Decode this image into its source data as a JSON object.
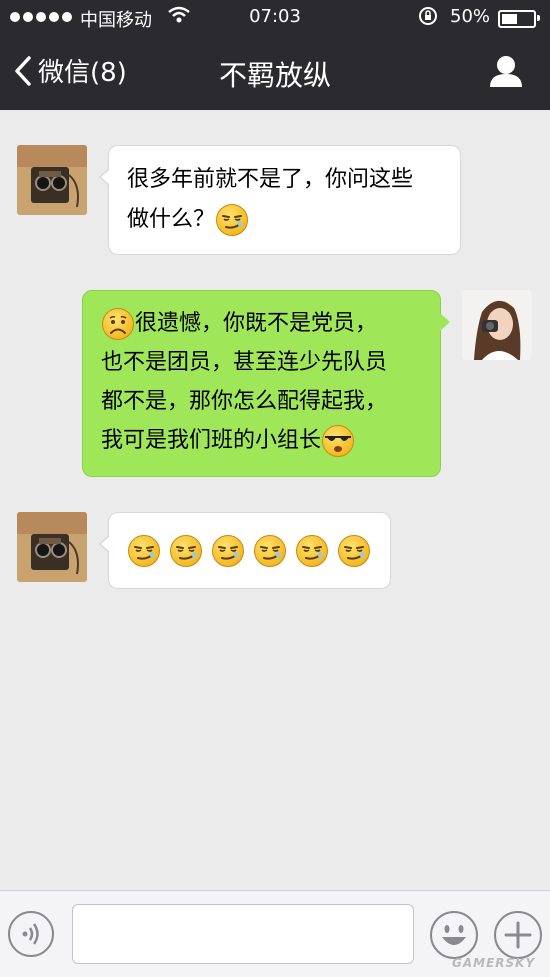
{
  "status_bar": {
    "carrier": "中国移动",
    "time": "07:03",
    "battery_pct": "50%",
    "battery_level": 0.5
  },
  "nav": {
    "back_label": "微信(8)",
    "title": "不羁放纵"
  },
  "messages": [
    {
      "direction": "incoming",
      "lines": [
        "很多年前就不是了，你问这些",
        "做什么？"
      ],
      "emojis": [
        "smirk-emoji"
      ]
    },
    {
      "direction": "outgoing",
      "lines": [
        "很遗憾，你既不是党员，",
        "也不是团员，甚至连少先队员",
        "都不是，那你怎么配得起我，",
        "我可是我们班的小组长"
      ],
      "emojis": [
        "sad-emoji",
        "cool-emoji"
      ]
    },
    {
      "direction": "incoming",
      "lines": [],
      "emojis": [
        "smirk-emoji",
        "smirk-emoji",
        "smirk-emoji",
        "smirk-emoji",
        "smirk-emoji",
        "smirk-emoji"
      ]
    }
  ],
  "input": {
    "value": "",
    "placeholder": ""
  },
  "watermark": "GAMERSKY",
  "colors": {
    "header_bg": "#2b2b2f",
    "chat_bg": "#ebebeb",
    "outgoing_bubble": "#9fe759",
    "incoming_bubble": "#ffffff"
  }
}
